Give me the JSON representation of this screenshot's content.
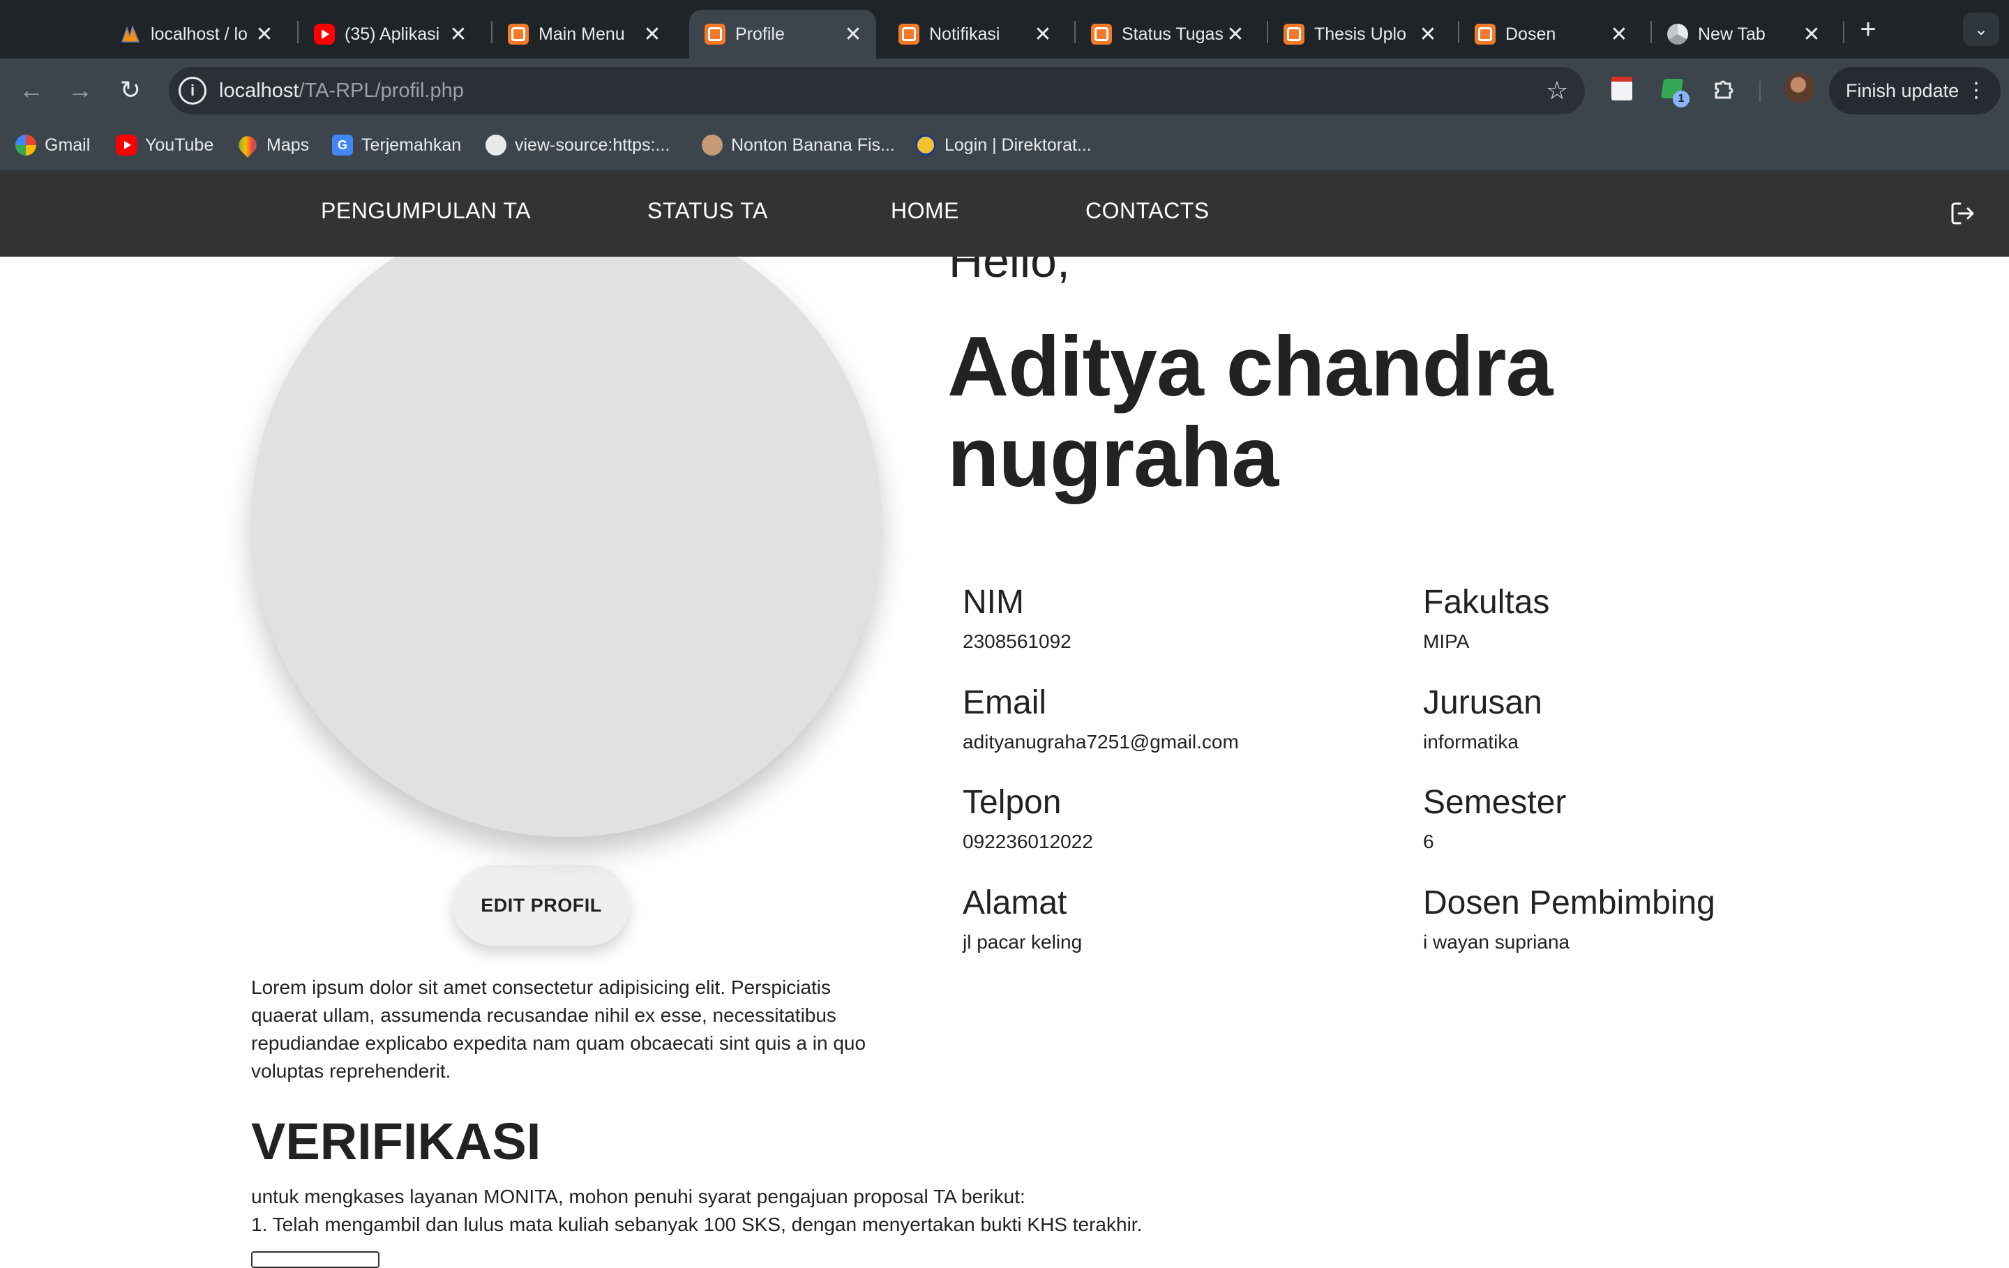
{
  "browser": {
    "tabs": [
      {
        "title": "localhost / lo",
        "icon": "phpmyadmin-icon"
      },
      {
        "title": "(35) Aplikasi",
        "icon": "youtube-icon"
      },
      {
        "title": "Main Menu",
        "icon": "xampp-icon"
      },
      {
        "title": "Profile",
        "icon": "xampp-icon",
        "active": true
      },
      {
        "title": "Notifikasi",
        "icon": "xampp-icon"
      },
      {
        "title": "Status Tugas",
        "icon": "xampp-icon"
      },
      {
        "title": "Thesis Uplo",
        "icon": "xampp-icon"
      },
      {
        "title": "Dosen",
        "icon": "xampp-icon"
      },
      {
        "title": "New Tab",
        "icon": "chrome-icon"
      }
    ],
    "close_glyph": "✕",
    "new_tab_glyph": "+",
    "url_host": "localhost",
    "url_path": "/TA-RPL/profil.php",
    "extension_badge": "1",
    "finish_update_label": "Finish update",
    "bookmarks": [
      {
        "label": "Gmail",
        "icon": "gmail-icon"
      },
      {
        "label": "YouTube",
        "icon": "youtube-icon"
      },
      {
        "label": "Maps",
        "icon": "maps-icon"
      },
      {
        "label": "Terjemahkan",
        "icon": "translate-icon"
      },
      {
        "label": "view-source:https:...",
        "icon": "globe-icon"
      },
      {
        "label": "Nonton Banana Fis...",
        "icon": "face-icon"
      },
      {
        "label": "Login | Direktorat...",
        "icon": "login-icon"
      }
    ]
  },
  "site_nav": {
    "links": [
      "PENGUMPULAN TA",
      "STATUS TA",
      "HOME",
      "CONTACTS"
    ],
    "logout_icon": "logout-icon"
  },
  "profile": {
    "greeting": "Hello,",
    "name": "Aditya chandra nugraha",
    "edit_button": "EDIT PROFIL",
    "bio": "Lorem ipsum dolor sit amet consectetur adipisicing elit. Perspiciatis quaerat ullam, assumenda recusandae nihil ex esse, necessitatibus repudiandae explicabo expedita nam quam obcaecati sint quis a in quo voluptas reprehenderit.",
    "fields": {
      "nim": {
        "label": "NIM",
        "value": "2308561092"
      },
      "email": {
        "label": "Email",
        "value": "adityanugraha7251@gmail.com"
      },
      "telpon": {
        "label": "Telpon",
        "value": "092236012022"
      },
      "alamat": {
        "label": "Alamat",
        "value": "jl pacar keling"
      },
      "fakultas": {
        "label": "Fakultas",
        "value": "MIPA"
      },
      "jurusan": {
        "label": "Jurusan",
        "value": "informatika"
      },
      "semester": {
        "label": "Semester",
        "value": "6"
      },
      "dosen": {
        "label": "Dosen Pembimbing",
        "value": "i wayan supriana"
      }
    }
  },
  "verifikasi": {
    "title": "VERIFIKASI",
    "intro": "untuk mengkases layanan MONITA, mohon penuhi syarat pengajuan proposal TA berikut:",
    "item1": "1. Telah mengambil dan lulus mata kuliah sebanyak 100 SKS, dengan menyertakan bukti KHS terakhir."
  },
  "colors": {
    "tabstrip": "#1f2428",
    "toolbar": "#3c454c",
    "site_nav": "#333333",
    "photo_placeholder": "#e2e0e0",
    "text": "#222222"
  }
}
